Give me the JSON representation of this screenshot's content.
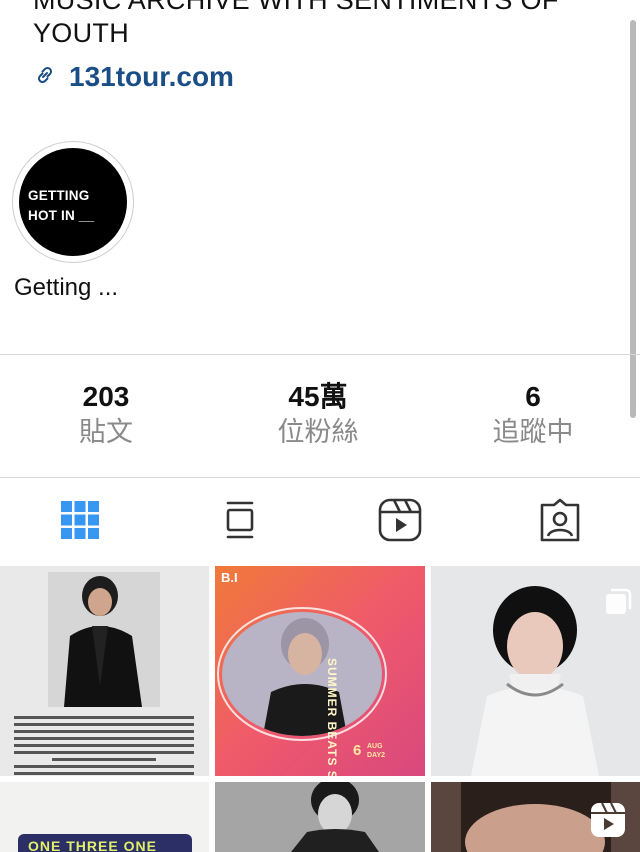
{
  "profile": {
    "bio_line1": "MUSIC ARCHIVE WITH SENTIMENTS OF",
    "bio_line2": "YOUTH",
    "link": "131tour.com"
  },
  "highlight": {
    "cover_line1": "GETTING",
    "cover_line2": "HOT IN __",
    "label": "Getting ..."
  },
  "stats": [
    {
      "value": "203",
      "label": "貼文"
    },
    {
      "value": "45萬",
      "label": "位粉絲"
    },
    {
      "value": "6",
      "label": "追蹤中"
    }
  ],
  "tabs": [
    {
      "name": "grid",
      "icon": "grid-icon",
      "active": true
    },
    {
      "name": "guides",
      "icon": "guide-icon",
      "active": false
    },
    {
      "name": "reels",
      "icon": "reels-icon",
      "active": false
    },
    {
      "name": "tagged",
      "icon": "tagged-icon",
      "active": false
    }
  ],
  "posts": {
    "p2_brand": "B.I",
    "p2_title": "SUMMER BEATS STAGE",
    "p2_date_num": "6",
    "p2_date_month": "AUG",
    "p2_day": "DAY2",
    "p4_text": "ONE THREE ONE"
  },
  "colors": {
    "link": "#1b4e86",
    "active_tab": "#3897f0",
    "inactive_tab": "#333333"
  }
}
